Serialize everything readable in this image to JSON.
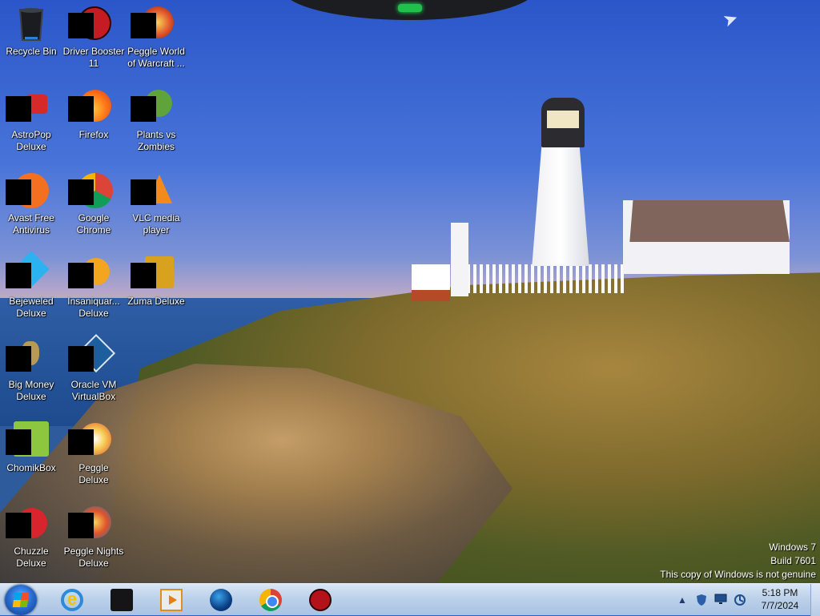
{
  "desktop": {
    "icons": [
      {
        "label": "Recycle Bin",
        "icon": "recycle-bin-icon"
      },
      {
        "label": "Driver Booster 11",
        "icon": "driver-booster-icon"
      },
      {
        "label": "Peggle World of Warcraft ...",
        "icon": "peggle-wow-icon"
      },
      {
        "label": "AstroPop Deluxe",
        "icon": "astropop-icon"
      },
      {
        "label": "Firefox",
        "icon": "firefox-icon"
      },
      {
        "label": "Plants vs Zombies",
        "icon": "plants-vs-zombies-icon"
      },
      {
        "label": "Avast Free Antivirus",
        "icon": "avast-icon"
      },
      {
        "label": "Google Chrome",
        "icon": "chrome-icon"
      },
      {
        "label": "VLC media player",
        "icon": "vlc-icon"
      },
      {
        "label": "Bejeweled Deluxe",
        "icon": "bejeweled-icon"
      },
      {
        "label": "Insaniquar... Deluxe",
        "icon": "insaniquarium-icon"
      },
      {
        "label": "Zuma Deluxe",
        "icon": "zuma-icon"
      },
      {
        "label": "Big Money Deluxe",
        "icon": "big-money-icon"
      },
      {
        "label": "Oracle VM VirtualBox",
        "icon": "virtualbox-icon"
      },
      {
        "label": "ChomikBox",
        "icon": "chomikbox-icon"
      },
      {
        "label": "Peggle Deluxe",
        "icon": "peggle-icon"
      },
      {
        "label": "Chuzzle Deluxe",
        "icon": "chuzzle-icon"
      },
      {
        "label": "Peggle Nights Deluxe",
        "icon": "peggle-nights-icon"
      }
    ],
    "watermark": {
      "line1": "Windows 7",
      "line2": "Build 7601",
      "line3": "This copy of Windows is not genuine"
    }
  },
  "taskbar": {
    "start_icon": "windows-start-icon",
    "pinned": [
      {
        "name": "internet-explorer",
        "icon": "internet-explorer-icon",
        "glyph": "e"
      },
      {
        "name": "dark-app",
        "icon": "dark-app-icon"
      },
      {
        "name": "media-player",
        "icon": "media-player-icon"
      },
      {
        "name": "globe-app",
        "icon": "globe-icon"
      },
      {
        "name": "google-chrome",
        "icon": "chrome-icon"
      },
      {
        "name": "driver-booster",
        "icon": "driver-booster-icon"
      }
    ],
    "tray": {
      "show_hidden": "▲",
      "icons": [
        "shield-icon",
        "monitor-icon",
        "network-icon"
      ]
    },
    "clock": {
      "time": "5:18 PM",
      "date": "7/7/2024"
    }
  }
}
